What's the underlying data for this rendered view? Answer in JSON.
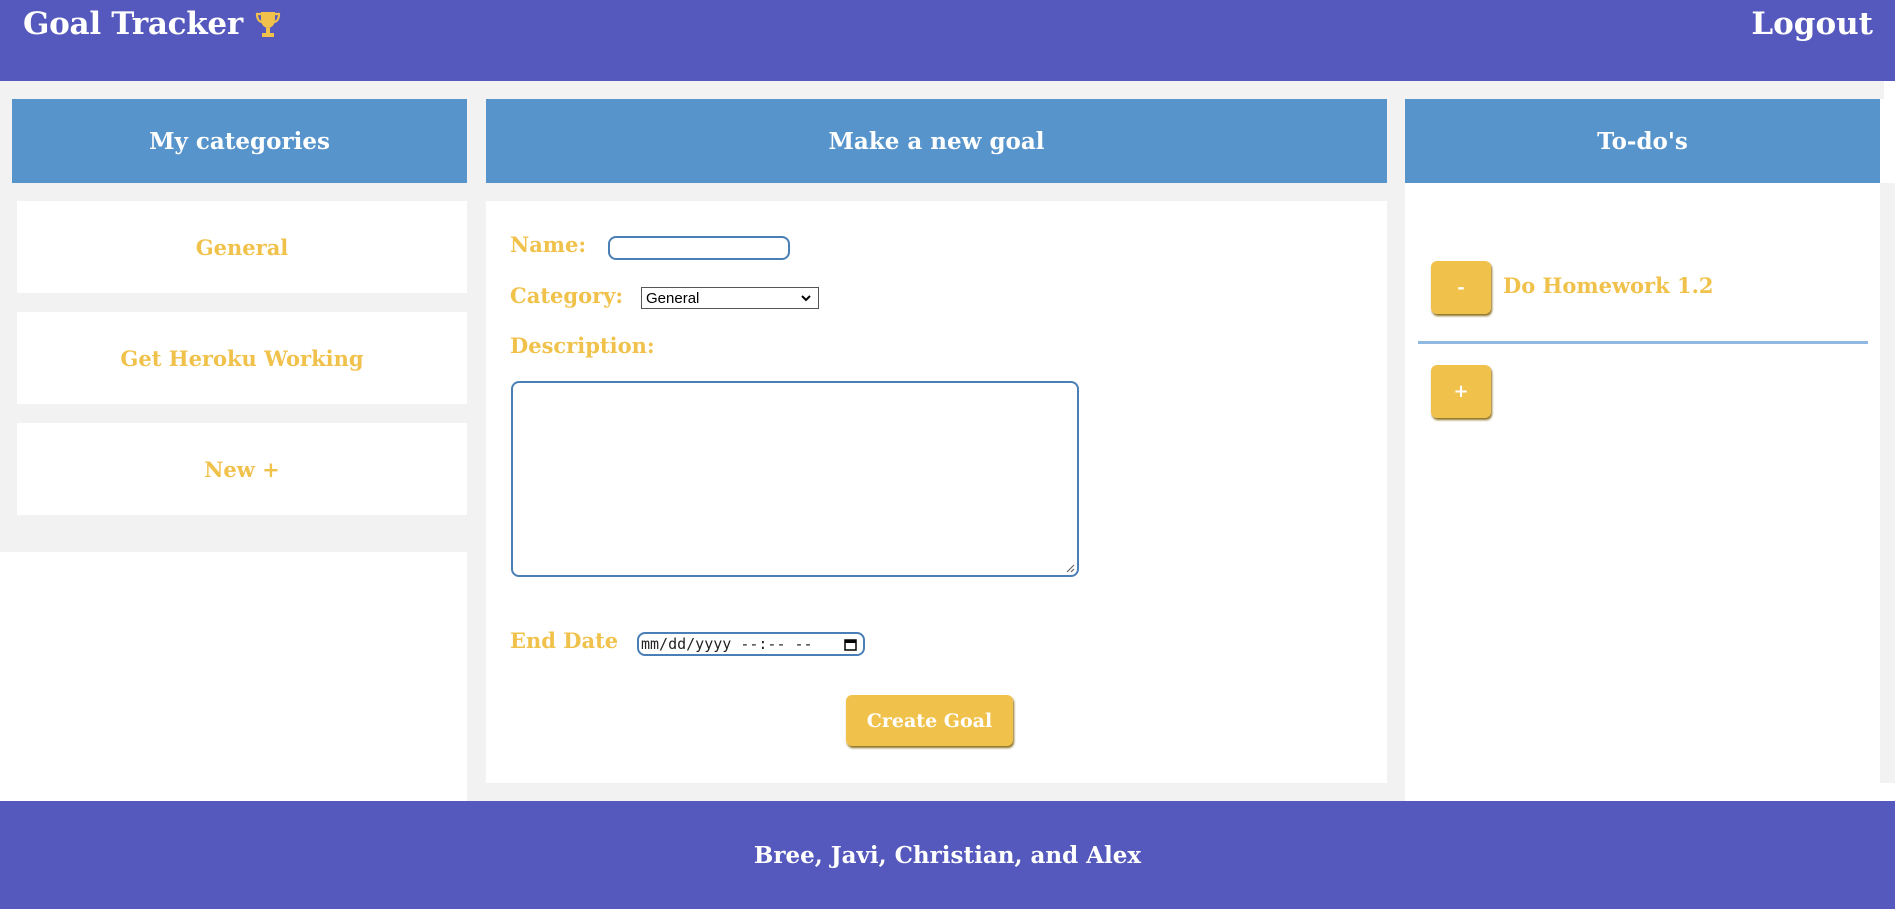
{
  "header": {
    "title": "Goal Tracker",
    "trophy_icon": "trophy-icon",
    "logout_label": "Logout"
  },
  "colors": {
    "header_bg": "#5558bc",
    "panel_head_bg": "#5794cb",
    "accent_yellow": "#f0c24c",
    "panel_bg": "#f2f2f2"
  },
  "categories": {
    "heading": "My categories",
    "items": [
      "General",
      "Get Heroku Working",
      "New +"
    ]
  },
  "new_goal": {
    "heading": "Make a new goal",
    "name_label": "Name:",
    "name_value": "",
    "category_label": "Category:",
    "category_selected": "General",
    "description_label": "Description:",
    "description_value": "",
    "end_date_label": "End Date",
    "end_date_placeholder": "mm/dd/yyyy --:-- --",
    "submit_label": "Create Goal"
  },
  "todos": {
    "heading": "To-do's",
    "items": [
      {
        "button_label": "-",
        "text": "Do Homework 1.2"
      }
    ],
    "add_label": "+"
  },
  "footer": {
    "credits": "Bree, Javi, Christian, and Alex"
  }
}
